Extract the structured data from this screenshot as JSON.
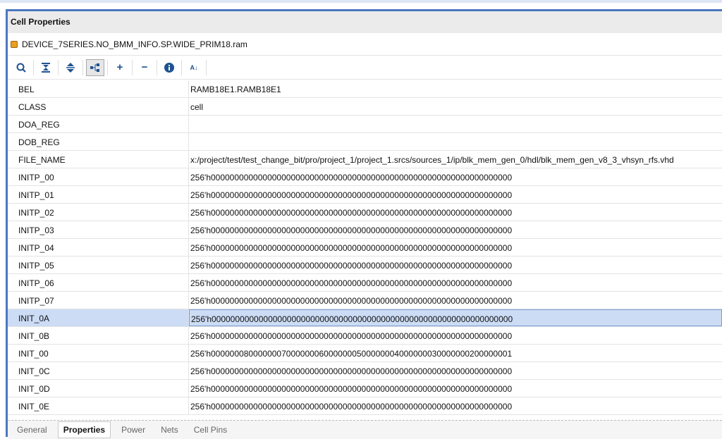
{
  "panel": {
    "title": "Cell Properties",
    "object": "DEVICE_7SERIES.NO_BMM_INFO.SP.WIDE_PRIM18.ram"
  },
  "toolbar": [
    "search-icon",
    "collapse-all-icon",
    "expand-all-icon",
    "hierarchy-icon",
    "plus-icon",
    "minus-icon",
    "info-icon",
    "sort-az-icon"
  ],
  "rows": [
    {
      "k": "BEL",
      "v": "RAMB18E1.RAMB18E1"
    },
    {
      "k": "CLASS",
      "v": "cell"
    },
    {
      "k": "DOA_REG",
      "v": ""
    },
    {
      "k": "DOB_REG",
      "v": ""
    },
    {
      "k": "FILE_NAME",
      "v": "x:/project/test/test_change_bit/pro/project_1/project_1.srcs/sources_1/ip/blk_mem_gen_0/hdl/blk_mem_gen_v8_3_vhsyn_rfs.vhd"
    },
    {
      "k": "INITP_00",
      "v": "256'h0000000000000000000000000000000000000000000000000000000000000000"
    },
    {
      "k": "INITP_01",
      "v": "256'h0000000000000000000000000000000000000000000000000000000000000000"
    },
    {
      "k": "INITP_02",
      "v": "256'h0000000000000000000000000000000000000000000000000000000000000000"
    },
    {
      "k": "INITP_03",
      "v": "256'h0000000000000000000000000000000000000000000000000000000000000000"
    },
    {
      "k": "INITP_04",
      "v": "256'h0000000000000000000000000000000000000000000000000000000000000000"
    },
    {
      "k": "INITP_05",
      "v": "256'h0000000000000000000000000000000000000000000000000000000000000000"
    },
    {
      "k": "INITP_06",
      "v": "256'h0000000000000000000000000000000000000000000000000000000000000000"
    },
    {
      "k": "INITP_07",
      "v": "256'h0000000000000000000000000000000000000000000000000000000000000000"
    },
    {
      "k": "INIT_0A",
      "v": "256'h0000000000000000000000000000000000000000000000000000000000000000"
    },
    {
      "k": "INIT_0B",
      "v": "256'h0000000000000000000000000000000000000000000000000000000000000000"
    },
    {
      "k": "INIT_00",
      "v": "256'h0000000800000007000000060000000500000004000000030000000200000001"
    },
    {
      "k": "INIT_0C",
      "v": "256'h0000000000000000000000000000000000000000000000000000000000000000"
    },
    {
      "k": "INIT_0D",
      "v": "256'h0000000000000000000000000000000000000000000000000000000000000000"
    },
    {
      "k": "INIT_0E",
      "v": "256'h0000000000000000000000000000000000000000000000000000000000000000"
    }
  ],
  "selected_row": "INIT_0A",
  "tabs": [
    "General",
    "Properties",
    "Power",
    "Nets",
    "Cell Pins"
  ],
  "active_tab": "Properties"
}
